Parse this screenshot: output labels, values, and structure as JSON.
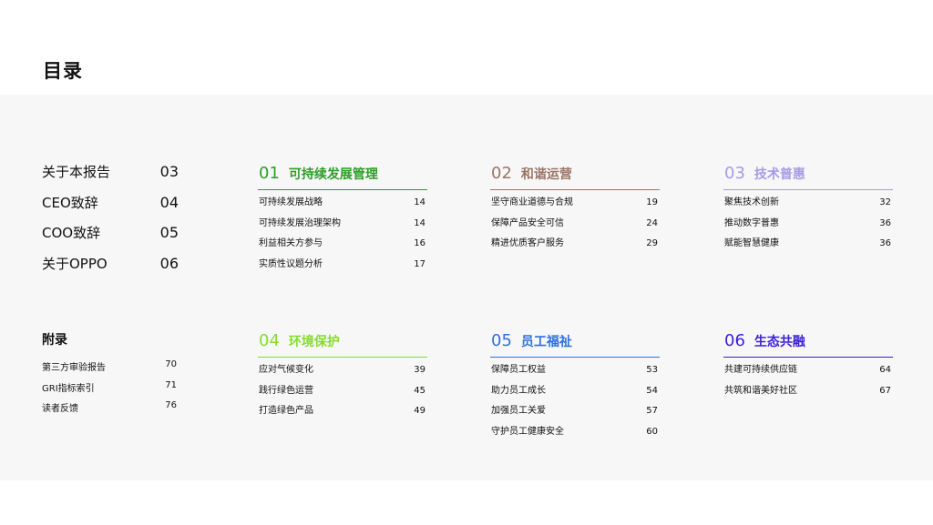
{
  "page": {
    "title": "目录"
  },
  "main_chapters": [
    {
      "label": "关于本报告",
      "page": "03"
    },
    {
      "label": "CEO致辞",
      "page": "04"
    },
    {
      "label": "COO致辞",
      "page": "05"
    },
    {
      "label": "关于OPPO",
      "page": "06"
    }
  ],
  "appendix": {
    "title": "附录",
    "items": [
      {
        "label": "第三方审验报告",
        "page": "70"
      },
      {
        "label": "GRI指标索引",
        "page": "71"
      },
      {
        "label": "读者反馈",
        "page": "76"
      }
    ]
  },
  "sections": [
    {
      "num": "01",
      "title": "可持续发展管理",
      "color": "#2e9e2a",
      "items": [
        {
          "label": "可持续发展战略",
          "page": "14"
        },
        {
          "label": "可持续发展治理架构",
          "page": "14"
        },
        {
          "label": "利益相关方参与",
          "page": "16"
        },
        {
          "label": "实质性议题分析",
          "page": "17"
        }
      ]
    },
    {
      "num": "02",
      "title": "和谐运营",
      "color": "#9a7566",
      "items": [
        {
          "label": "坚守商业道德与合规",
          "page": "19"
        },
        {
          "label": "保障产品安全可信",
          "page": "24"
        },
        {
          "label": "精进优质客户服务",
          "page": "29"
        }
      ]
    },
    {
      "num": "03",
      "title": "技术普惠",
      "color": "#a79be6",
      "items": [
        {
          "label": "聚焦技术创新",
          "page": "32"
        },
        {
          "label": "推动数字普惠",
          "page": "36"
        },
        {
          "label": "赋能智慧健康",
          "page": "36"
        }
      ]
    },
    {
      "num": "04",
      "title": "环境保护",
      "color": "#86dc2d",
      "items": [
        {
          "label": "应对气候变化",
          "page": "39"
        },
        {
          "label": "践行绿色运营",
          "page": "45"
        },
        {
          "label": "打造绿色产品",
          "page": "49"
        }
      ]
    },
    {
      "num": "05",
      "title": "员工福祉",
      "color": "#2f6fe0",
      "items": [
        {
          "label": "保障员工权益",
          "page": "53"
        },
        {
          "label": "助力员工成长",
          "page": "54"
        },
        {
          "label": "加强员工关爱",
          "page": "57"
        },
        {
          "label": "守护员工健康安全",
          "page": "60"
        }
      ]
    },
    {
      "num": "06",
      "title": "生态共融",
      "color": "#3a1fd6",
      "items": [
        {
          "label": "共建可持续供应链",
          "page": "64"
        },
        {
          "label": "共筑和谐美好社区",
          "page": "67"
        }
      ]
    }
  ]
}
